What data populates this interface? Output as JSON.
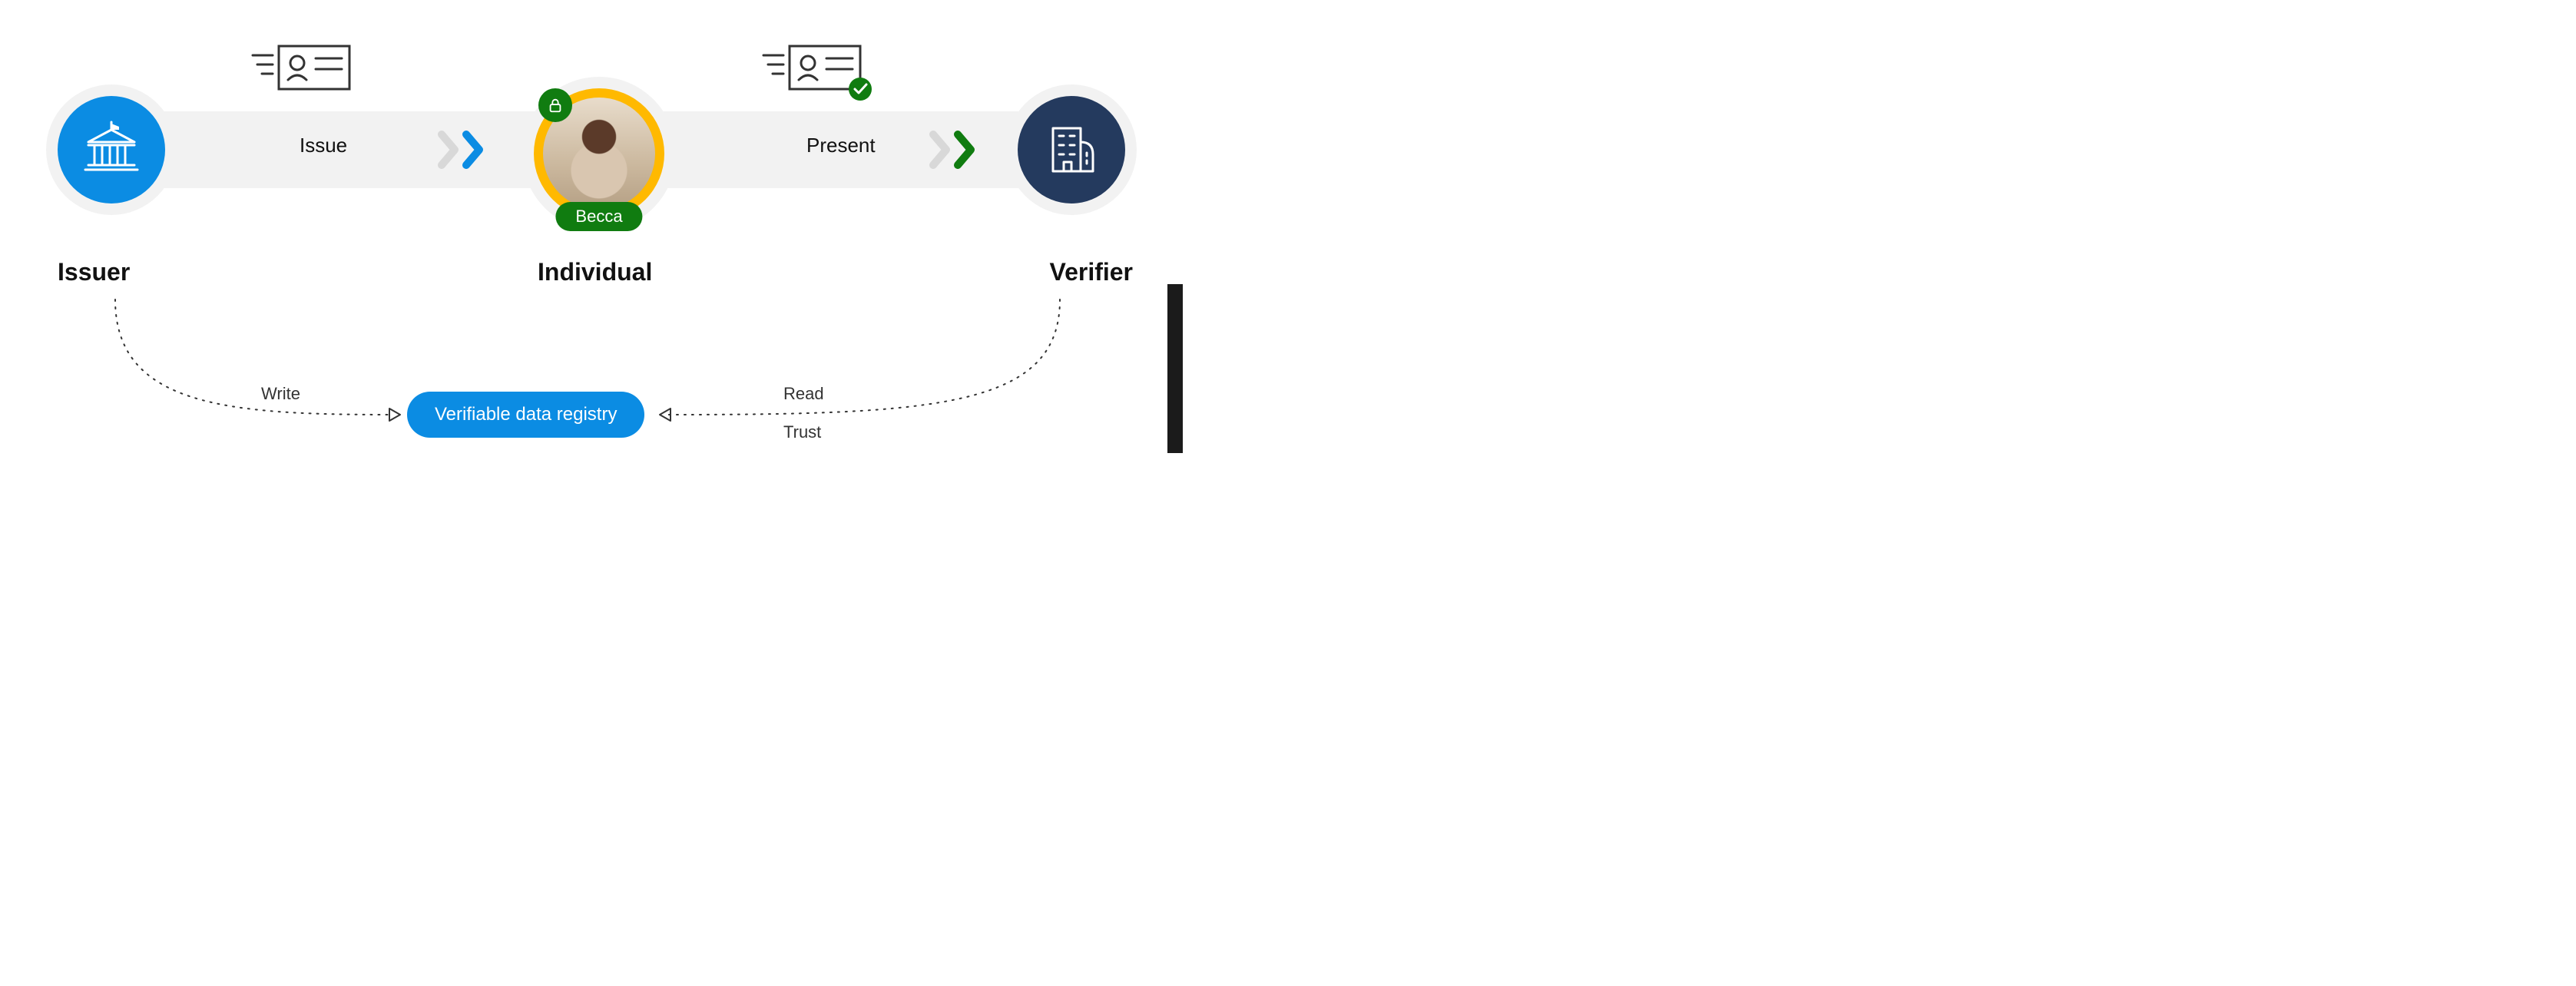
{
  "entities": {
    "issuer": {
      "label": "Issuer"
    },
    "individual": {
      "label": "Individual",
      "name": "Becca"
    },
    "verifier": {
      "label": "Verifier"
    }
  },
  "flow": {
    "issue": "Issue",
    "present": "Present"
  },
  "registry": {
    "label": "Verifiable data registry",
    "write": "Write",
    "read": "Read",
    "trust": "Trust"
  },
  "colors": {
    "issuer_bg": "#0b8ce3",
    "verifier_bg": "#243a5e",
    "individual_ring": "#ffb900",
    "accent_green": "#107c10",
    "flow_bg": "#f2f2f2"
  }
}
